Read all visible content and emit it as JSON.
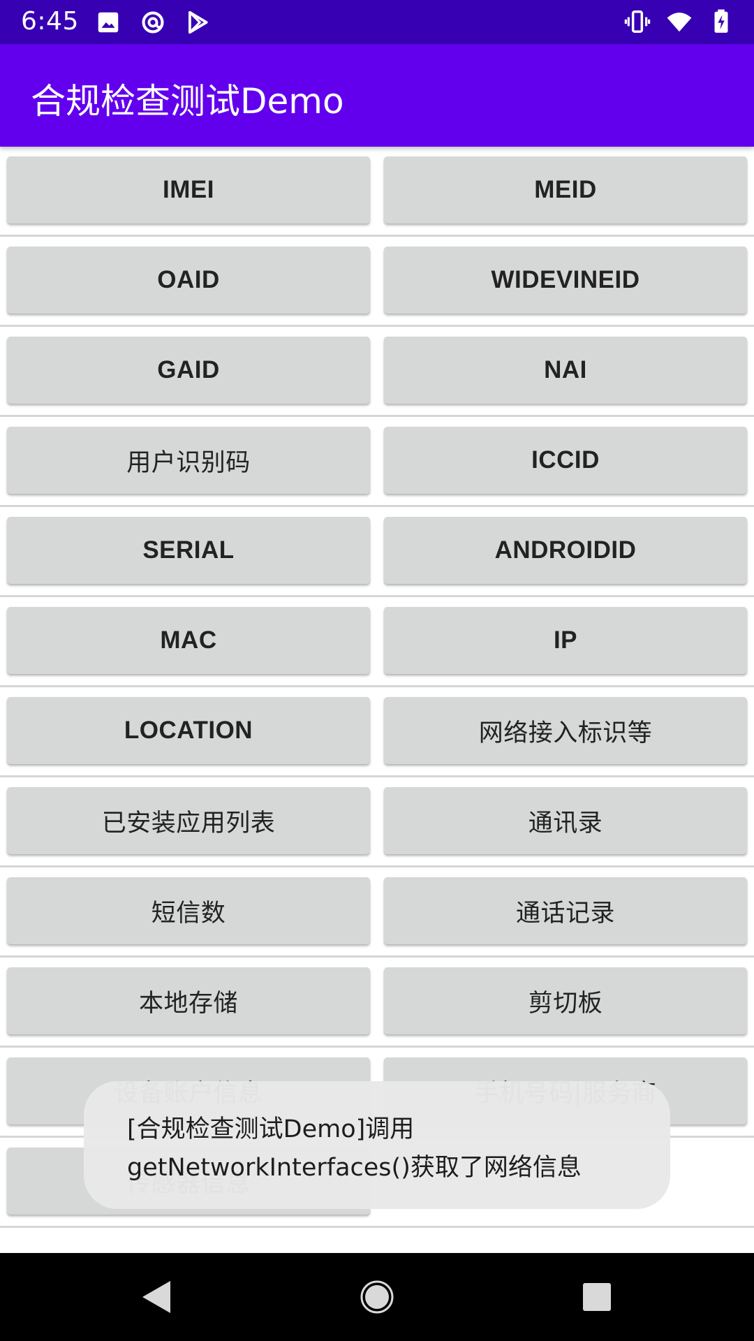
{
  "status_bar": {
    "time": "6:45",
    "left_icons": [
      "image-icon",
      "at-sign-icon",
      "play-store-icon"
    ],
    "right_icons": [
      "vibrate-icon",
      "wifi-icon",
      "battery-charging-icon"
    ]
  },
  "app_bar": {
    "title": "合规检查测试Demo"
  },
  "buttons": [
    {
      "left": "IMEI",
      "right": "MEID"
    },
    {
      "left": "OAID",
      "right": "WIDEVINEID"
    },
    {
      "left": "GAID",
      "right": "NAI"
    },
    {
      "left": "用户识别码",
      "right": "ICCID"
    },
    {
      "left": "SERIAL",
      "right": "ANDROIDID"
    },
    {
      "left": "MAC",
      "right": "IP"
    },
    {
      "left": "LOCATION",
      "right": "网络接入标识等"
    },
    {
      "left": "已安装应用列表",
      "right": "通讯录"
    },
    {
      "left": "短信数",
      "right": "通话记录"
    },
    {
      "left": "本地存储",
      "right": "剪切板"
    },
    {
      "left": "设备账户信息",
      "right": "手机号码|服务商"
    },
    {
      "left": "传感器信息"
    }
  ],
  "toast": {
    "line1": "[合规检查测试Demo]调用",
    "line2": "getNetworkInterfaces()获取了网络信息"
  },
  "nav_bar": {
    "icons": [
      "back-icon",
      "home-icon",
      "recents-icon"
    ]
  },
  "colors": {
    "status_bar": "#3700b3",
    "app_bar": "#6200ee",
    "button": "#d6d7d7",
    "toast": "#e8e8e8",
    "nav_bar": "#000000"
  }
}
